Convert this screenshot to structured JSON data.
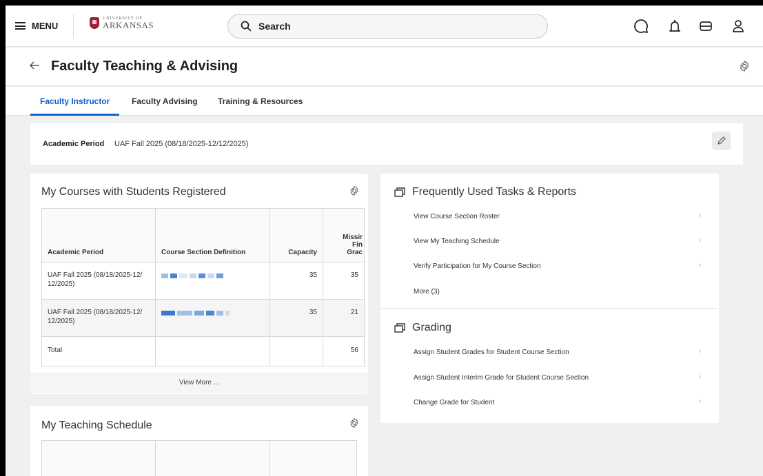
{
  "topbar": {
    "menu_label": "MENU",
    "logo_small": "UNIVERSITY OF",
    "logo_big": "ARKANSAS",
    "search_placeholder": "Search"
  },
  "page": {
    "title": "Faculty Teaching & Advising"
  },
  "tabs": [
    {
      "label": "Faculty Instructor",
      "active": true
    },
    {
      "label": "Faculty Advising",
      "active": false
    },
    {
      "label": "Training & Resources",
      "active": false
    }
  ],
  "period": {
    "label": "Academic Period",
    "value": "UAF Fall 2025 (08/18/2025-12/12/2025)"
  },
  "courses": {
    "title": "My Courses with Students Registered",
    "headers": [
      "Academic Period",
      "Course Section Definition",
      "Capacity",
      "Missir\nFin\nGrac"
    ],
    "rows": [
      {
        "period": "UAF Fall 2025 (08/18/2025-12/\n12/2025)",
        "capacity": "35",
        "missing": "35"
      },
      {
        "period": "UAF Fall 2025 (08/18/2025-12/\n12/2025)",
        "capacity": "35",
        "missing": "21"
      }
    ],
    "total": {
      "label": "Total",
      "missing": "56"
    },
    "view_more": "View More ..."
  },
  "schedule": {
    "title": "My Teaching Schedule"
  },
  "tasks": {
    "title": "Frequently Used Tasks & Reports",
    "items": [
      "View Course Section Roster",
      "View My Teaching Schedule",
      "Verify Participation for My Course Section",
      "More (3)"
    ]
  },
  "grading": {
    "title": "Grading",
    "items": [
      "Assign Student Grades for Student Course Section",
      "Assign Student Interim Grade for Student Course Section",
      "Change Grade for Student"
    ]
  },
  "colors": {
    "accent": "#0b63ce",
    "brand": "#9d2235"
  }
}
